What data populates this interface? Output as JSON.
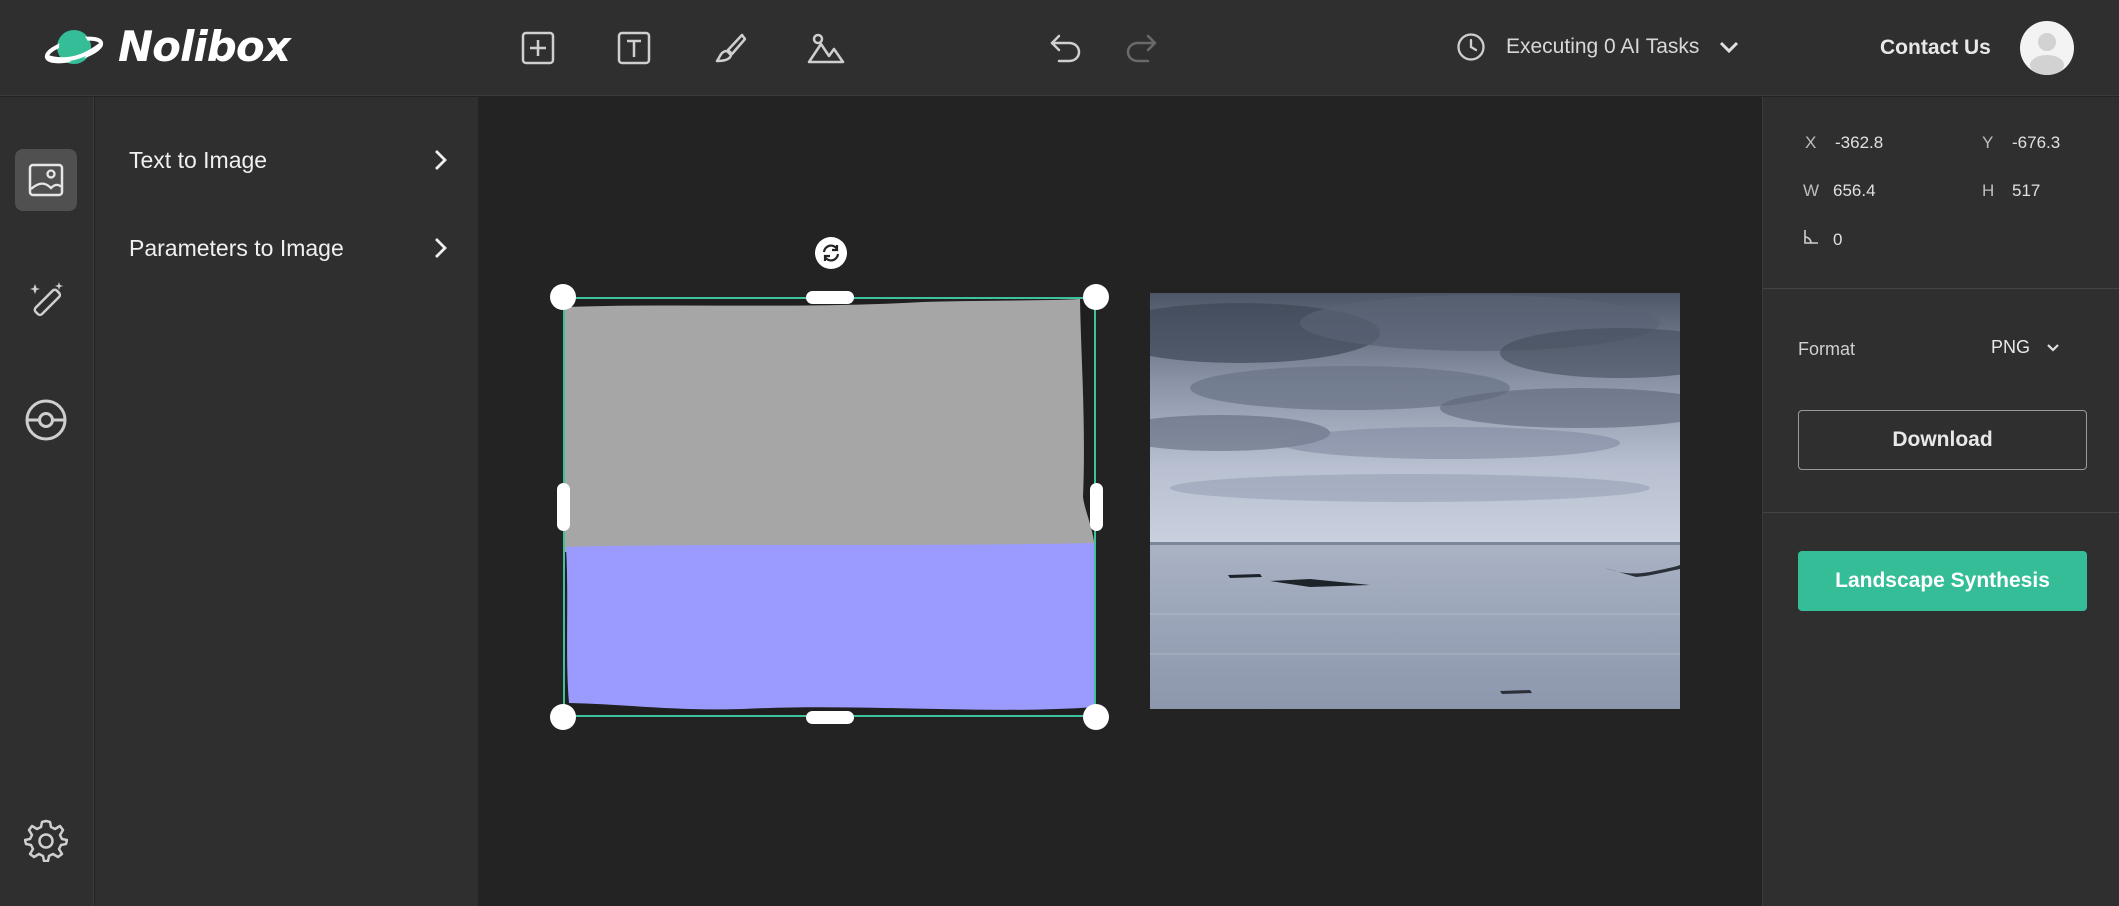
{
  "app": {
    "name": "Nolibox"
  },
  "toolbar": {
    "tools": [
      "add-frame-icon",
      "text-tool-icon",
      "brush-icon",
      "image-icon"
    ],
    "undo_icon": "undo-icon",
    "redo_icon": "redo-icon",
    "executing_label": "Executing 0 AI Tasks",
    "contact_label": "Contact Us"
  },
  "rail": {
    "items": [
      {
        "icon": "image-gallery-icon",
        "active": true
      },
      {
        "icon": "magic-wand-icon",
        "active": false
      },
      {
        "icon": "pokeball-icon",
        "active": false
      }
    ],
    "settings_icon": "gear-icon"
  },
  "panel": {
    "items": [
      {
        "label": "Text to Image"
      },
      {
        "label": "Parameters to Image"
      }
    ]
  },
  "props": {
    "x_label": "X",
    "x_value": "-362.8",
    "y_label": "Y",
    "y_value": "-676.3",
    "w_label": "W",
    "w_value": "656.4",
    "h_label": "H",
    "h_value": "517",
    "angle_value": "0",
    "format_label": "Format",
    "format_value": "PNG",
    "download_label": "Download",
    "synthesis_label": "Landscape Synthesis"
  },
  "colors": {
    "accent": "#35bd97",
    "sky_segment": "#a6a6a6",
    "water_segment": "#9b9bff"
  }
}
